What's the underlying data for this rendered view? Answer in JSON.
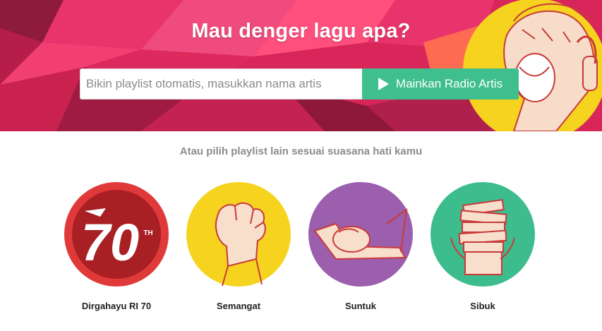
{
  "hero": {
    "title": "Mau denger lagu apa?",
    "search_placeholder": "Bikin playlist otomatis, masukkan nama artis",
    "radio_button_label": "Mainkan Radio Artis"
  },
  "subtitle": "Atau pilih playlist lain sesuai suasana hati kamu",
  "moods": [
    {
      "label": "Dirgahayu RI 70",
      "badge": "70",
      "badge_sup": "TH",
      "circle_color": "#e0393a",
      "icon": "ri-70-icon"
    },
    {
      "label": "Semangat",
      "circle_color": "#f5d31e",
      "icon": "raised-fist-icon"
    },
    {
      "label": "Suntuk",
      "circle_color": "#9b5fae",
      "icon": "head-on-laptop-icon"
    },
    {
      "label": "Sibuk",
      "circle_color": "#3dbd8e",
      "icon": "stack-of-books-icon"
    }
  ],
  "colors": {
    "hero_background": "#d9265a",
    "accent_green": "#3fbf8e",
    "singer_circle": "#f5d31e"
  }
}
